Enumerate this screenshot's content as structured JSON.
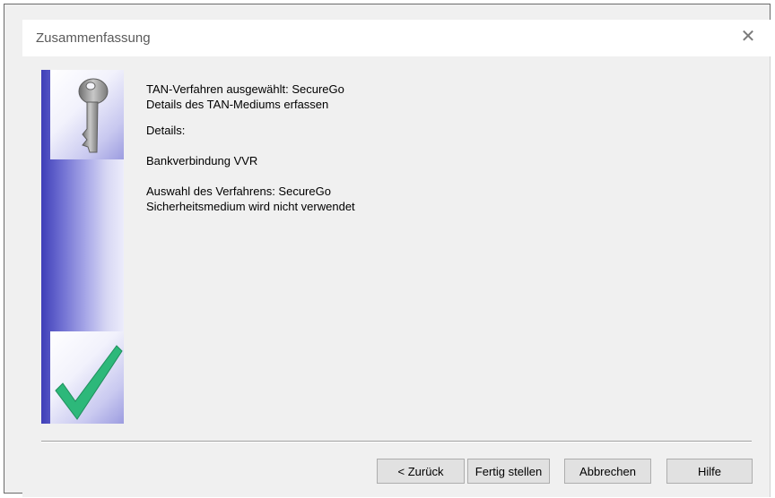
{
  "window": {
    "title": "Zusammenfassung",
    "close_glyph": "✕"
  },
  "icons": {
    "top": "key-icon",
    "bottom": "checkmark-icon",
    "check_color": "#2db87a",
    "key_color": "#8a8a8a"
  },
  "content": {
    "line1": "TAN-Verfahren ausgewählt: SecureGo",
    "line2": "Details des TAN-Mediums erfassen",
    "details_label": "Details:",
    "bank_connection": "Bankverbindung VVR",
    "method_selection": "Auswahl des Verfahrens: SecureGo",
    "security_medium": "Sicherheitsmedium wird nicht verwendet"
  },
  "buttons": {
    "back": "< Zurück",
    "finish": "Fertig stellen",
    "cancel": "Abbrechen",
    "help": "Hilfe"
  }
}
